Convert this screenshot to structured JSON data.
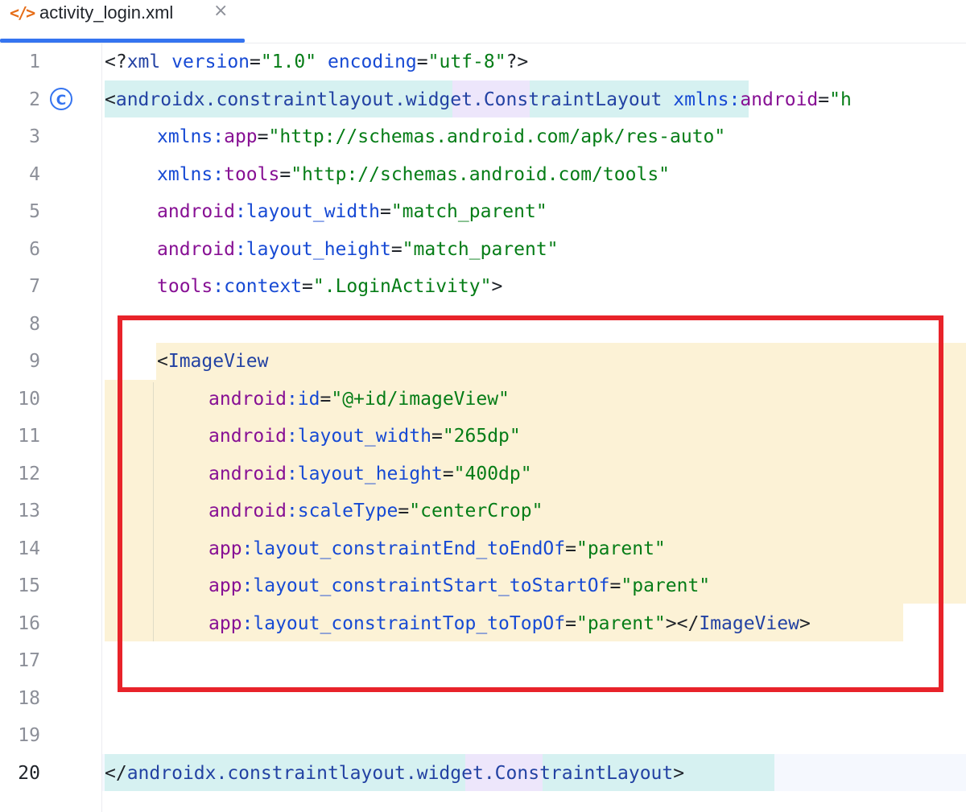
{
  "tab": {
    "title": "activity_login.xml",
    "icon": "</>",
    "close": "×"
  },
  "line_numbers": [
    "1",
    "2",
    "3",
    "4",
    "5",
    "6",
    "7",
    "8",
    "9",
    "10",
    "11",
    "12",
    "13",
    "14",
    "15",
    "16",
    "17",
    "18",
    "19",
    "20"
  ],
  "gutter_icon": "C",
  "code": {
    "l1": {
      "a": "<?",
      "b": "xml",
      "c": " version",
      "d": "=",
      "e": "\"1.0\"",
      "f": " encoding",
      "g": "=",
      "h": "\"utf-8\"",
      "i": "?>"
    },
    "l2": {
      "a": "<",
      "b": "androidx.constraintlayout.",
      "c": "widget",
      "d": ".ConstraintLayout",
      "e": " xmlns:",
      "f": "android",
      "g": "=",
      "h": "\"h"
    },
    "l3": {
      "a": "xmlns:",
      "b": "app",
      "c": "=",
      "d": "\"http://schemas.android.com/apk/res-auto\""
    },
    "l4": {
      "a": "xmlns:",
      "b": "tools",
      "c": "=",
      "d": "\"http://schemas.android.com/tools\""
    },
    "l5": {
      "a": "android",
      "b": ":layout_width",
      "c": "=",
      "d": "\"match_parent\""
    },
    "l6": {
      "a": "android",
      "b": ":layout_height",
      "c": "=",
      "d": "\"match_parent\""
    },
    "l7": {
      "a": "tools",
      "b": ":context",
      "c": "=",
      "d": "\".LoginActivity\"",
      "e": ">"
    },
    "l9": {
      "a": "<",
      "b": "ImageView"
    },
    "l10": {
      "a": "android",
      "b": ":id",
      "c": "=",
      "d": "\"@+id/imageView\""
    },
    "l11": {
      "a": "android",
      "b": ":layout_width",
      "c": "=",
      "d": "\"265dp\""
    },
    "l12": {
      "a": "android",
      "b": ":layout_height",
      "c": "=",
      "d": "\"400dp\""
    },
    "l13": {
      "a": "android",
      "b": ":scaleType",
      "c": "=",
      "d": "\"centerCrop\""
    },
    "l14": {
      "a": "app",
      "b": ":layout_constraintEnd_toEndOf",
      "c": "=",
      "d": "\"parent\""
    },
    "l15": {
      "a": "app",
      "b": ":layout_constraintStart_toStartOf",
      "c": "=",
      "d": "\"parent\""
    },
    "l16": {
      "a": "app",
      "b": ":layout_constraintTop_toTopOf",
      "c": "=",
      "d": "\"parent\"",
      "e": "></",
      "f": "ImageView",
      "g": ">"
    },
    "l20": {
      "a": "</",
      "b": "androidx.constraintlayout.",
      "c": "widget",
      "d": ".ConstraintLayout",
      "e": ">"
    }
  },
  "colors": {
    "tag": "#2342a3",
    "attribute": "#871094",
    "value": "#067d17",
    "highlight": "#fcf2d6",
    "annotation_box": "#e8232a",
    "tab_accent": "#3574f0"
  }
}
